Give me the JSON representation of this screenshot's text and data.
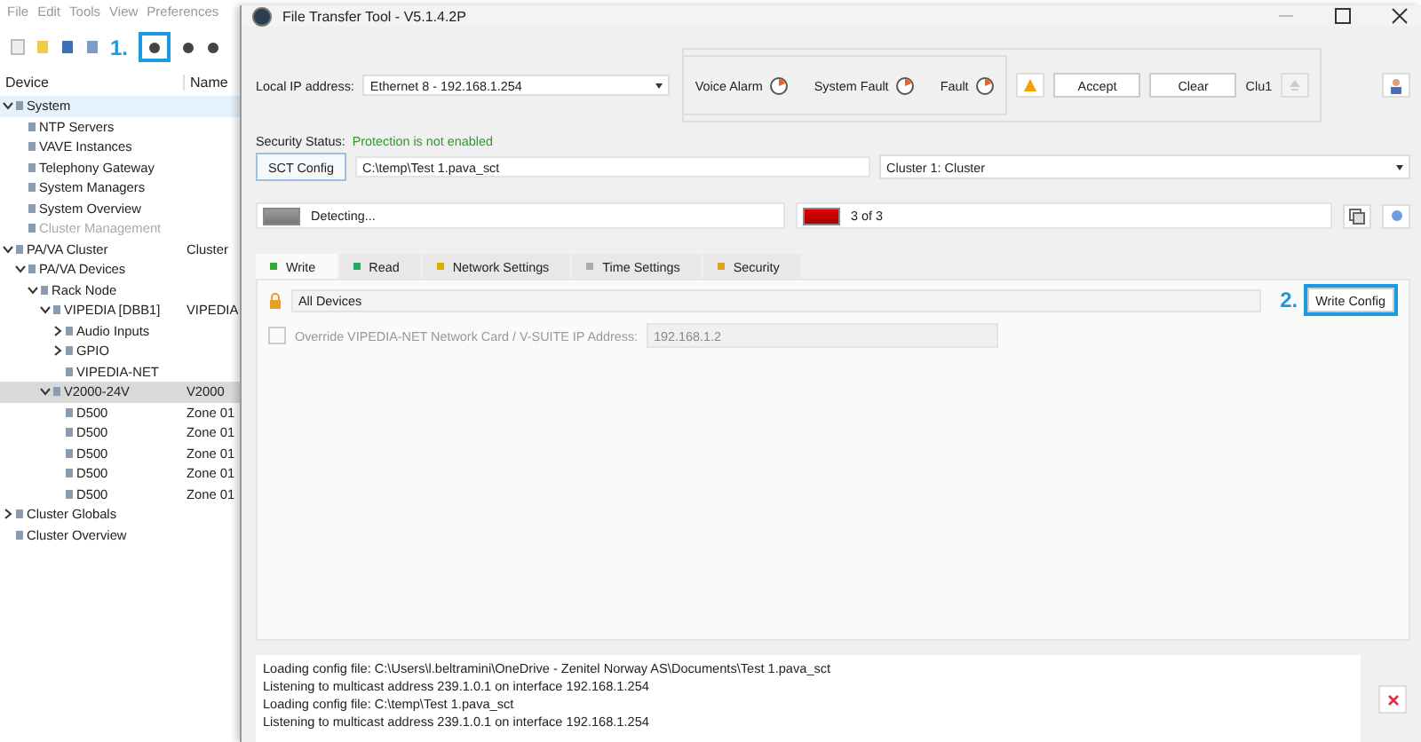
{
  "app": {
    "menu": [
      "File",
      "Edit",
      "Tools",
      "View",
      "Preferences"
    ],
    "toolbar_callout": "1.",
    "tree_columns": [
      "Device",
      "Name"
    ],
    "tree": [
      {
        "label": "System",
        "expanded": true,
        "selected": false,
        "hovered": true,
        "disabled": false,
        "children": [
          {
            "label": "NTP Servers",
            "selected": false,
            "hovered": false,
            "disabled": false
          },
          {
            "label": "VAVE Instances",
            "selected": false,
            "hovered": false,
            "disabled": false
          },
          {
            "label": "Telephony Gateway",
            "selected": false,
            "hovered": false,
            "disabled": false
          },
          {
            "label": "System Managers",
            "selected": false,
            "hovered": false,
            "disabled": false
          },
          {
            "label": "System Overview",
            "selected": false,
            "hovered": false,
            "disabled": false
          },
          {
            "label": "Cluster Management",
            "selected": false,
            "hovered": false,
            "disabled": true
          }
        ]
      },
      {
        "label": "PA/VA Cluster",
        "name": "Cluster",
        "expanded": true,
        "selected": false,
        "hovered": false,
        "disabled": false,
        "children": [
          {
            "label": "PA/VA Devices",
            "expanded": true,
            "selected": false,
            "hovered": false,
            "disabled": false,
            "children": [
              {
                "label": "Rack Node",
                "expanded": true,
                "selected": false,
                "hovered": false,
                "disabled": false,
                "children": [
                  {
                    "label": "VIPEDIA [DBB1]",
                    "name": "VIPEDIA",
                    "expanded": true,
                    "selected": false,
                    "hovered": false,
                    "disabled": false,
                    "children": [
                      {
                        "label": "Audio Inputs",
                        "expanded": false,
                        "selected": false,
                        "hovered": false,
                        "disabled": false
                      },
                      {
                        "label": "GPIO",
                        "expanded": false,
                        "selected": false,
                        "hovered": false,
                        "disabled": false
                      },
                      {
                        "label": "VIPEDIA-NET",
                        "selected": false,
                        "hovered": false,
                        "disabled": false
                      }
                    ]
                  },
                  {
                    "label": "V2000-24V",
                    "name": "V2000",
                    "expanded": true,
                    "selected": true,
                    "hovered": false,
                    "disabled": false,
                    "children": [
                      {
                        "label": "D500",
                        "name": "Zone 01",
                        "selected": false,
                        "hovered": false,
                        "disabled": false
                      },
                      {
                        "label": "D500",
                        "name": "Zone 01",
                        "selected": false,
                        "hovered": false,
                        "disabled": false
                      },
                      {
                        "label": "D500",
                        "name": "Zone 01",
                        "selected": false,
                        "hovered": false,
                        "disabled": false
                      },
                      {
                        "label": "D500",
                        "name": "Zone 01",
                        "selected": false,
                        "hovered": false,
                        "disabled": false
                      },
                      {
                        "label": "D500",
                        "name": "Zone 01",
                        "selected": false,
                        "hovered": false,
                        "disabled": false
                      }
                    ]
                  }
                ]
              }
            ]
          }
        ]
      },
      {
        "label": "Cluster Globals",
        "expanded": false,
        "selected": false,
        "hovered": false,
        "disabled": false
      },
      {
        "label": "Cluster Overview",
        "selected": false,
        "hovered": false,
        "disabled": false
      }
    ]
  },
  "dialog": {
    "title": "File Transfer Tool - V5.1.4.2P",
    "local_ip_label": "Local IP address:",
    "local_ip_value": "Ethernet 8 - 192.168.1.254",
    "alarms": [
      "Voice Alarm",
      "System Fault",
      "Fault"
    ],
    "accept": "Accept",
    "clear": "Clear",
    "cluster_short": "Clu1",
    "security_label": "Security Status:",
    "security_value": "Protection is not enabled",
    "sct_button": "SCT Config",
    "sct_path": "C:\\temp\\Test 1.pava_sct",
    "cluster_select": "Cluster 1: Cluster",
    "detect_text": "Detecting...",
    "count_text": "3 of 3",
    "tabs": [
      {
        "label": "Write",
        "selected": true
      },
      {
        "label": "Read",
        "selected": false
      },
      {
        "label": "Network Settings",
        "selected": false
      },
      {
        "label": "Time Settings",
        "selected": false
      },
      {
        "label": "Security",
        "selected": false
      }
    ],
    "target": "All Devices",
    "write_callout": "2.",
    "write_button": "Write Config",
    "override": {
      "label": "Override VIPEDIA-NET Network Card / V-SUITE IP Address:",
      "checked": false,
      "value": "192.168.1.2"
    },
    "log": [
      "Loading config file: C:\\Users\\l.beltramini\\OneDrive - Zenitel Norway AS\\Documents\\Test 1.pava_sct",
      "Listening to multicast address 239.1.0.1 on interface 192.168.1.254",
      "Loading config file: C:\\temp\\Test 1.pava_sct",
      "Listening to multicast address 239.1.0.1 on interface 192.168.1.254"
    ]
  }
}
